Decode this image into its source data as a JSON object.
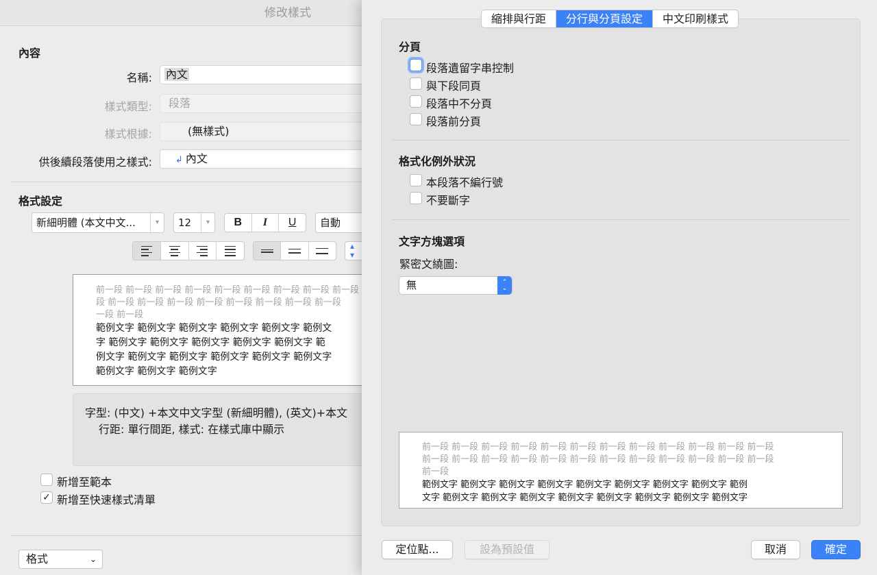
{
  "background_dialog": {
    "title": "修改樣式",
    "content_section": "內容",
    "name_label": "名稱:",
    "name_value": "內文",
    "style_type_label": "樣式類型:",
    "style_type_value": "段落",
    "based_on_label": "樣式根據:",
    "based_on_value": "(無樣式)",
    "next_style_label": "供後續段落使用之樣式:",
    "next_style_value": "內文",
    "format_section": "格式設定",
    "font_name": "新細明體 (本文中文...",
    "font_size": "12",
    "bold": "B",
    "italic": "I",
    "underline": "U",
    "color_value": "自動",
    "preview_prev_lines": [
      "前一段 前一段 前一段 前一段 前一段 前一段 前一段 前一段 前一段",
      "段 前一段 前一段 前一段 前一段 前一段 前一段 前一段 前一段",
      "一段 前一段"
    ],
    "preview_sample_lines": [
      "範例文字 範例文字 範例文字 範例文字 範例文字 範例文",
      "字 範例文字 範例文字 範例文字 範例文字 範例文字 範",
      "例文字 範例文字 範例文字 範例文字 範例文字 範例文字",
      "範例文字 範例文字 範例文字"
    ],
    "description_line1": "字型: (中文) +本文中文字型 (新細明體), (英文)+本文",
    "description_line2": "行距: 單行間距, 樣式: 在樣式庫中顯示",
    "add_to_template": {
      "label": "新增至範本",
      "checked": false
    },
    "add_to_quick_styles": {
      "label": "新增至快速樣式清單",
      "checked": true,
      "mark": "✓"
    },
    "format_menu": "格式"
  },
  "sheet": {
    "tabs": [
      {
        "label": "縮排與行距",
        "active": false
      },
      {
        "label": "分行與分頁設定",
        "active": true
      },
      {
        "label": "中文印刷樣式",
        "active": false
      }
    ],
    "pagination": {
      "heading": "分頁",
      "options": [
        {
          "label": "段落遺留字串控制",
          "checked": false,
          "focused": true
        },
        {
          "label": "與下段同頁",
          "checked": false
        },
        {
          "label": "段落中不分頁",
          "checked": false
        },
        {
          "label": "段落前分頁",
          "checked": false
        }
      ]
    },
    "exceptions": {
      "heading": "格式化例外狀況",
      "options": [
        {
          "label": "本段落不編行號",
          "checked": false
        },
        {
          "label": "不要斷字",
          "checked": false
        }
      ]
    },
    "textbox": {
      "heading": "文字方塊選項",
      "tight_wrap_label": "緊密文繞圖:",
      "tight_wrap_value": "無"
    },
    "preview_prev_lines": [
      "前一段 前一段 前一段 前一段 前一段 前一段 前一段 前一段 前一段 前一段 前一段 前一段",
      "前一段 前一段 前一段 前一段 前一段 前一段 前一段 前一段 前一段 前一段 前一段 前一段",
      "前一段"
    ],
    "preview_sample_lines": [
      "範例文字 範例文字 範例文字 範例文字 範例文字 範例文字 範例文字 範例文字 範例",
      "文字 範例文字 範例文字 範例文字 範例文字 範例文字 範例文字 範例文字 範例文字"
    ],
    "buttons": {
      "tabs_button": "定位點...",
      "set_default": "設為預設值",
      "cancel": "取消",
      "ok": "確定"
    }
  },
  "colors": {
    "accent": "#3b82f6"
  }
}
